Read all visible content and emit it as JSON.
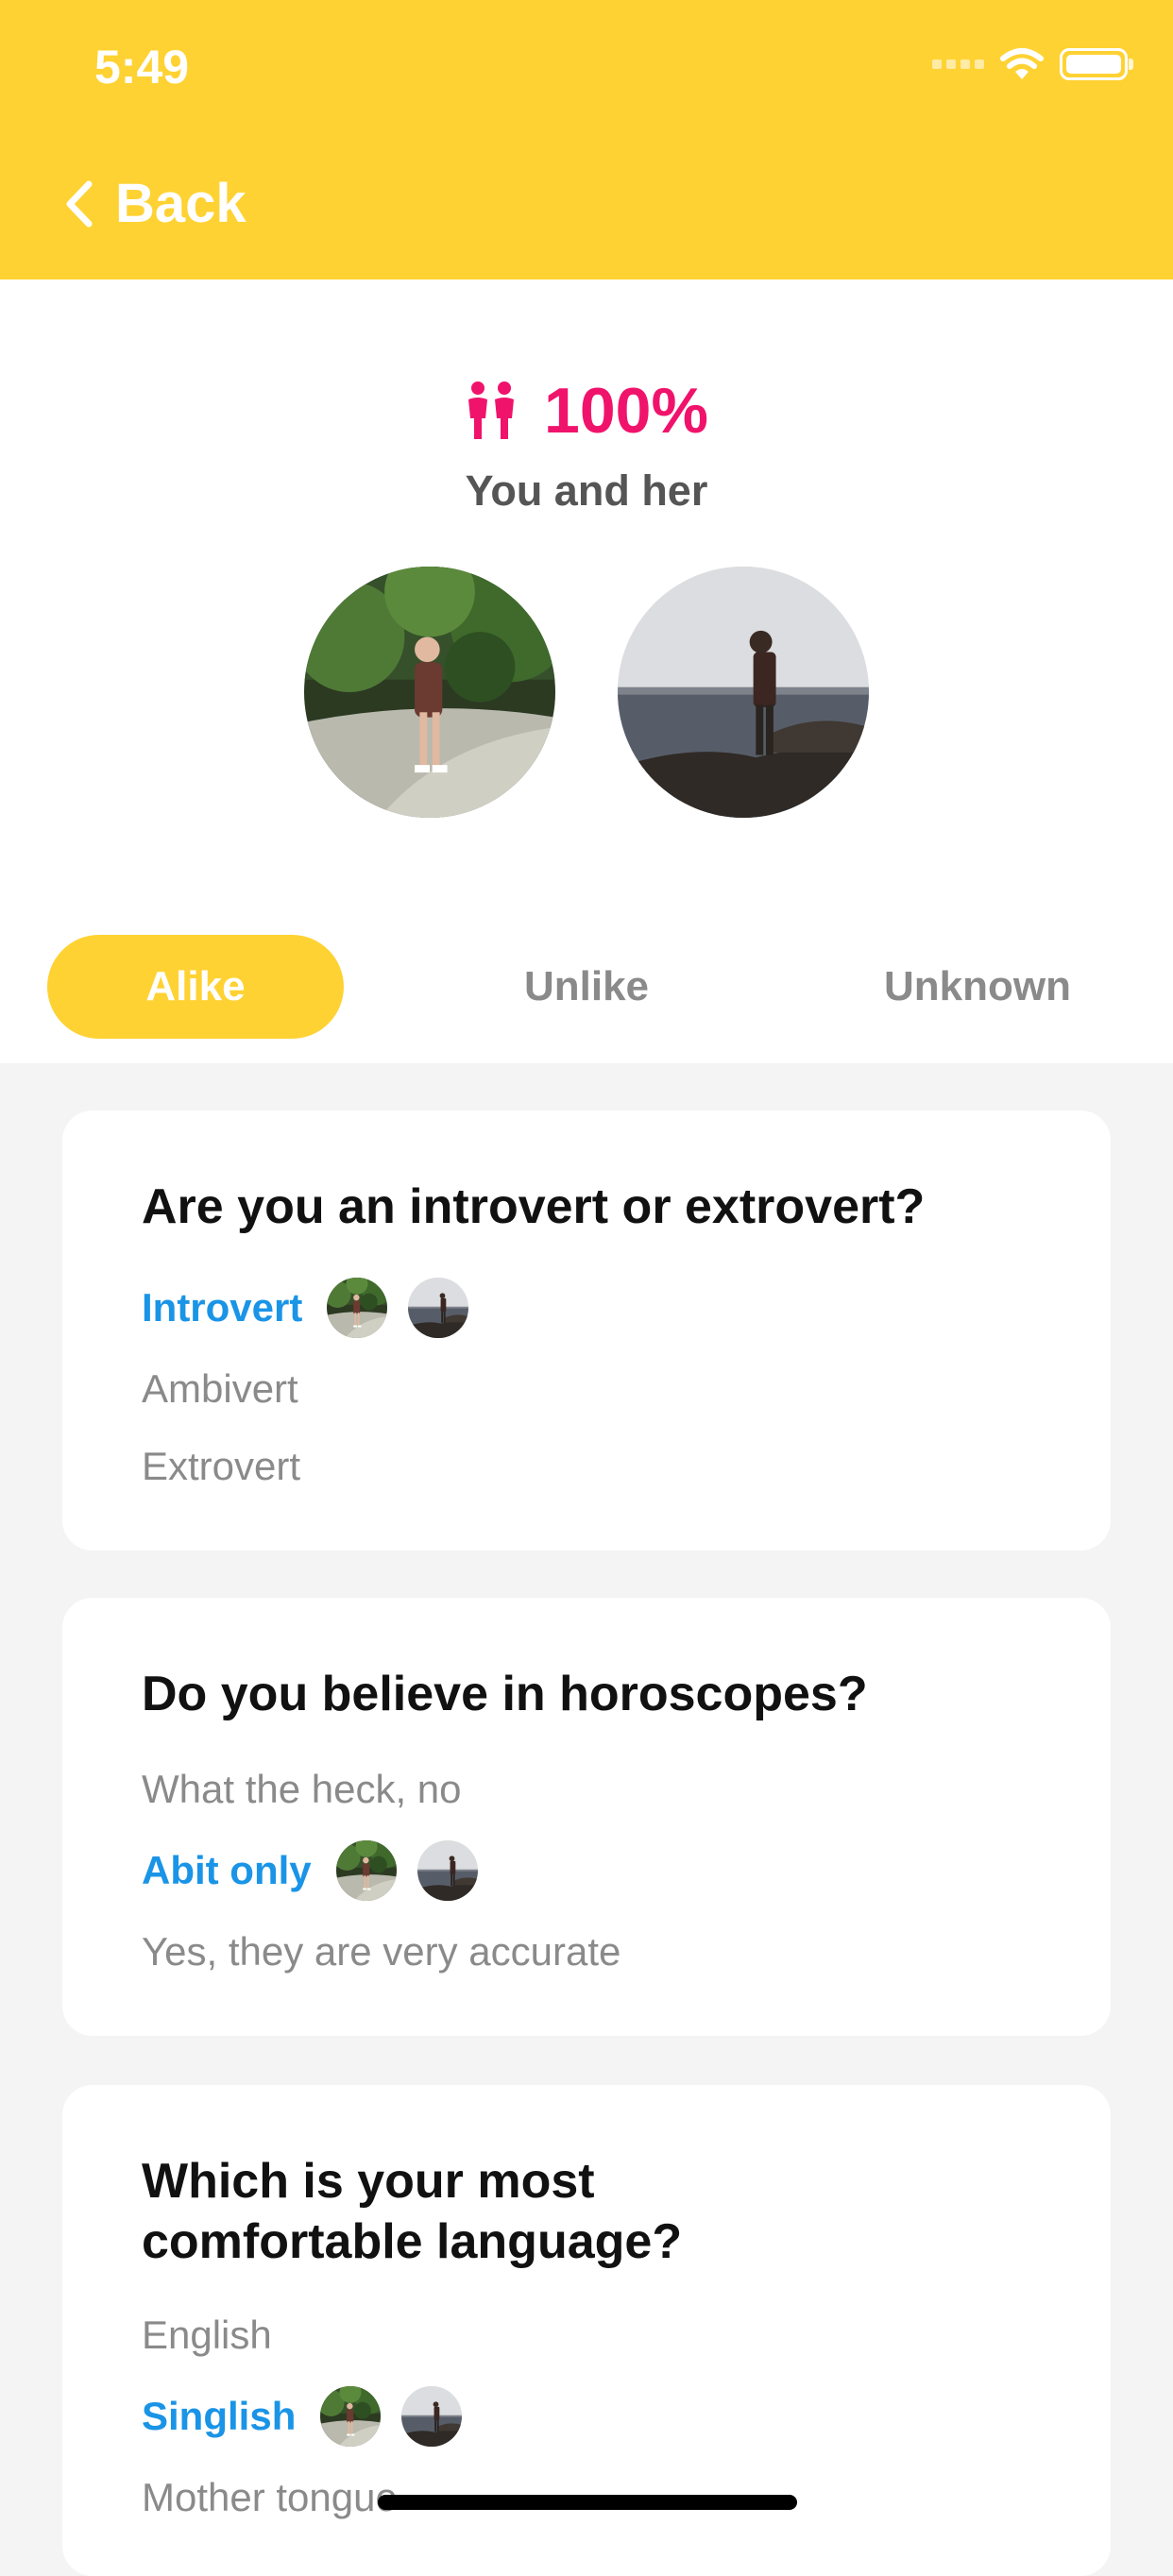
{
  "status_bar": {
    "time": "5:49"
  },
  "header": {
    "back_label": "Back",
    "background_color": "#FFD233"
  },
  "match": {
    "percent": "100%",
    "caption": "You and her",
    "accent_color": "#F0136B"
  },
  "tabs": [
    {
      "label": "Alike",
      "active": true
    },
    {
      "label": "Unlike",
      "active": false
    },
    {
      "label": "Unknown",
      "active": false
    }
  ],
  "questions": [
    {
      "question": "Are you an introvert or extrovert?",
      "options": [
        {
          "label": "Introvert",
          "selected": true
        },
        {
          "label": "Ambivert",
          "selected": false
        },
        {
          "label": "Extrovert",
          "selected": false
        }
      ]
    },
    {
      "question": "Do you believe in horoscopes?",
      "options": [
        {
          "label": "What the heck, no",
          "selected": false
        },
        {
          "label": "Abit only",
          "selected": true
        },
        {
          "label": "Yes, they are very accurate",
          "selected": false
        }
      ]
    },
    {
      "question": "Which is your most comfortable language?",
      "options": [
        {
          "label": "English",
          "selected": false
        },
        {
          "label": "Singlish",
          "selected": true
        },
        {
          "label": "Mother tongue",
          "selected": false
        }
      ]
    }
  ],
  "colors": {
    "selected_option": "#1A94E6",
    "unselected_option": "#8a8a8a",
    "page_background": "#f4f4f4"
  },
  "icons": {
    "back": "chevron-left-icon",
    "match": "couple-icon",
    "wifi": "wifi-icon",
    "battery": "battery-icon",
    "signal": "signal-icon"
  }
}
